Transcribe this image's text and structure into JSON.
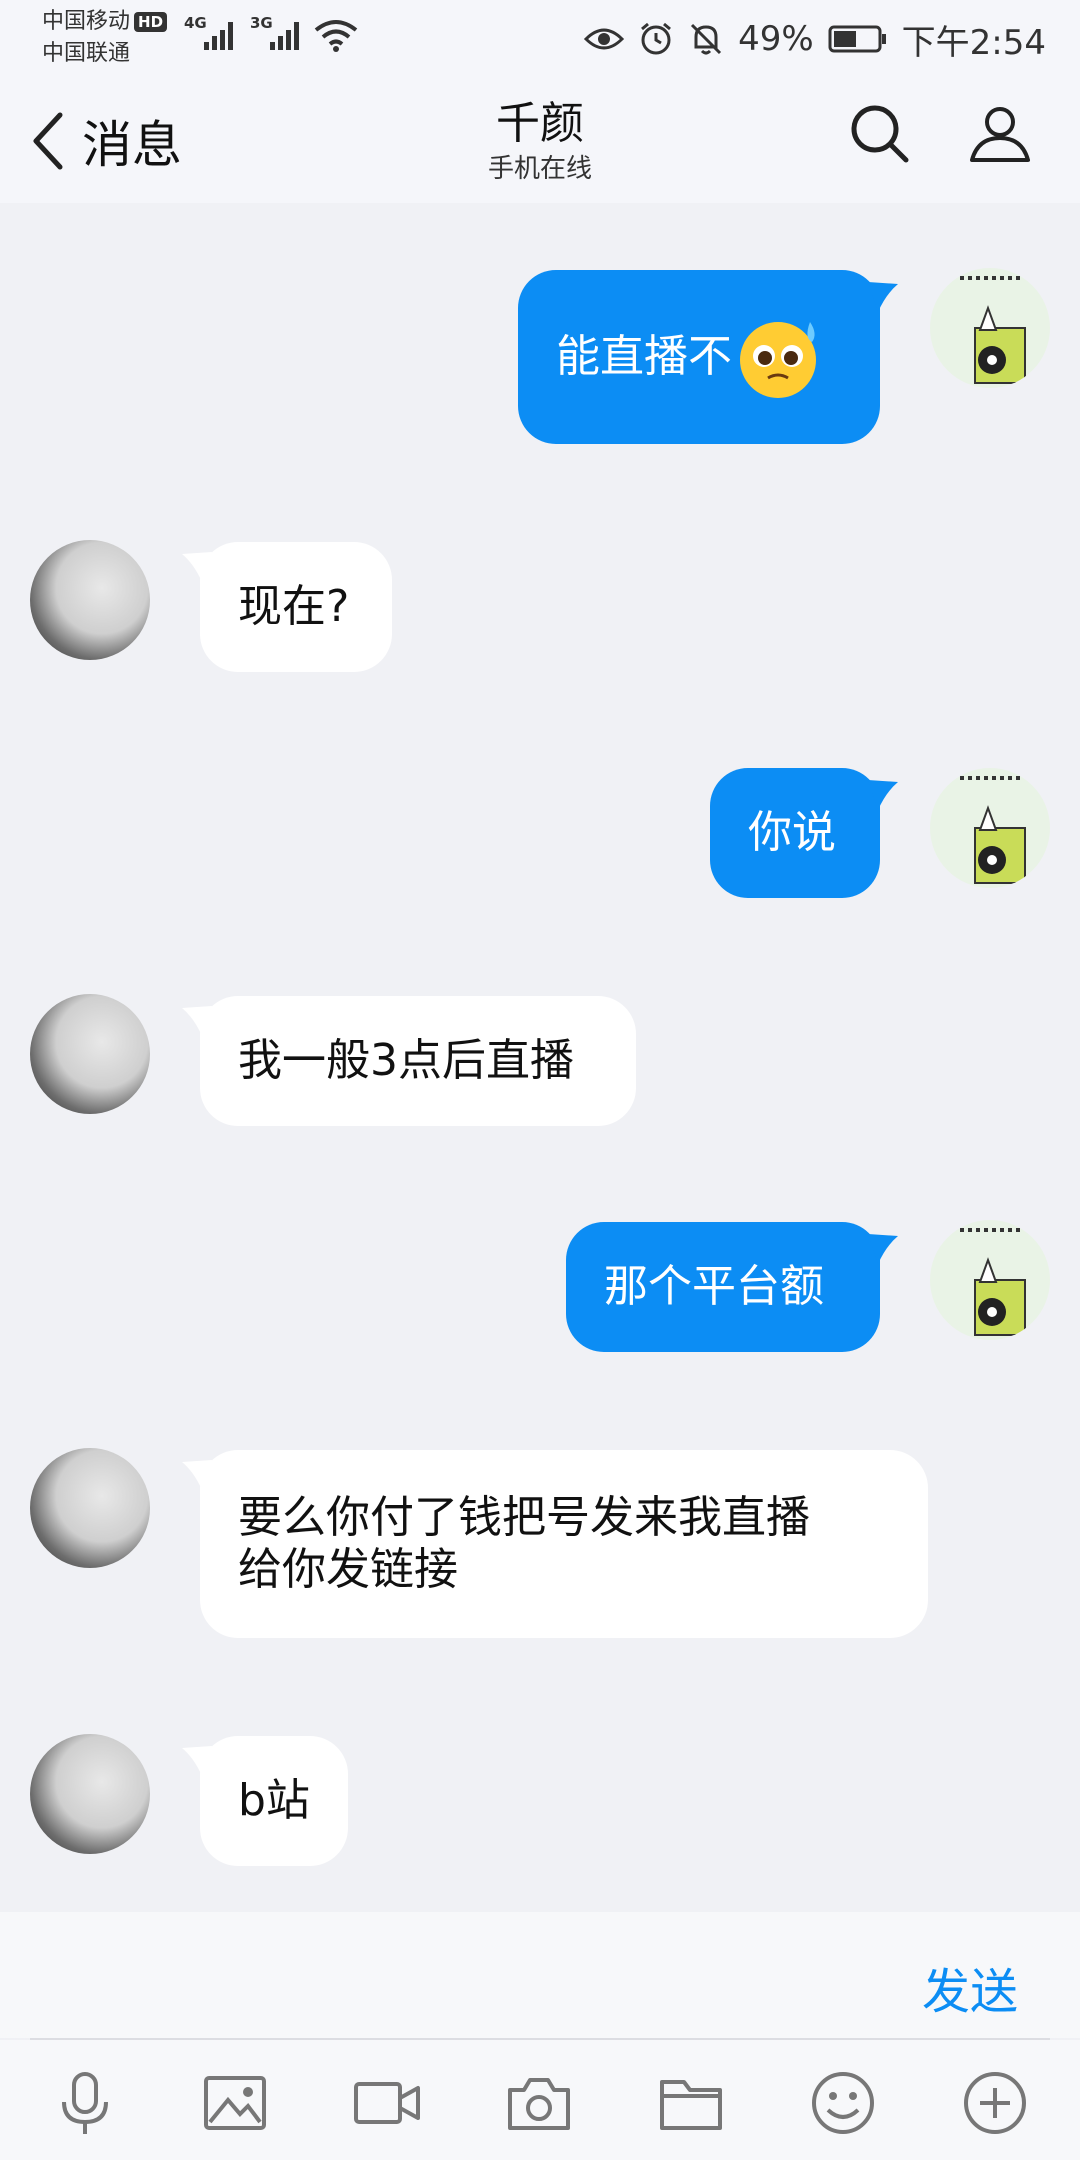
{
  "status_bar": {
    "carrier1": "中国移动",
    "hd": "HD",
    "net1": "4G",
    "net2": "3G",
    "carrier2": "中国联通",
    "battery": "49%",
    "time": "下午2:54"
  },
  "nav": {
    "back_label": "消息",
    "title": "千颜",
    "subtitle": "手机在线"
  },
  "messages": [
    {
      "side": "out",
      "text": "能直播不",
      "emoji": "pleading-face-emoji"
    },
    {
      "side": "in",
      "text": "现在?"
    },
    {
      "side": "out",
      "text": "你说"
    },
    {
      "side": "in",
      "text": "我一般3点后直播"
    },
    {
      "side": "out",
      "text": "那个平台额"
    },
    {
      "side": "in",
      "line1": "要么你付了钱把号发来我直播",
      "line2": "给你发链接"
    },
    {
      "side": "in",
      "text": "b站"
    }
  ],
  "input": {
    "send_label": "发送"
  },
  "toolbar": [
    "microphone-icon",
    "image-icon",
    "video-icon",
    "camera-icon",
    "folder-icon",
    "emoji-icon",
    "plus-icon"
  ],
  "colors": {
    "accent": "#0c8df4",
    "background": "#f0f1f5",
    "incoming_bubble": "#ffffff"
  }
}
